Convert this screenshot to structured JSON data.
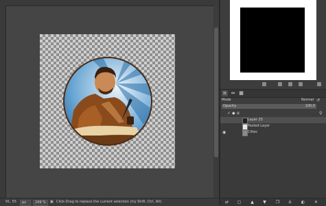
{
  "statusbar": {
    "coords": "91, 55",
    "unit": "px",
    "zoom": "249 %",
    "message": "Click-Drag to replace the current selection (try Shift, Ctrl, Alt)"
  },
  "layers_panel": {
    "mode_label": "Mode",
    "mode_value": "Normal",
    "opacity_label": "Opacity",
    "opacity_value": "100.0",
    "layers": [
      {
        "name": "Layer 25",
        "visible": false
      },
      {
        "name": "Pasted Layer",
        "visible": false
      },
      {
        "name": "Cities",
        "visible": true
      }
    ]
  },
  "colors": {
    "ui_bg": "#454545",
    "panel_bg": "#3d3d3d",
    "selected_row": "#505050"
  },
  "icons": {
    "dock_tabs": [
      "layers-icon",
      "channels-icon",
      "paths-icon"
    ],
    "preview_tools": [
      "navigate-icon",
      "zoom-out-icon",
      "zoom-in-icon",
      "zoom-fit-icon",
      "settings-icon"
    ],
    "layer_buttons": [
      "new-layer-icon",
      "new-group-icon",
      "raise-icon",
      "lower-icon",
      "duplicate-icon",
      "anchor-icon",
      "mask-icon",
      "delete-icon"
    ]
  }
}
